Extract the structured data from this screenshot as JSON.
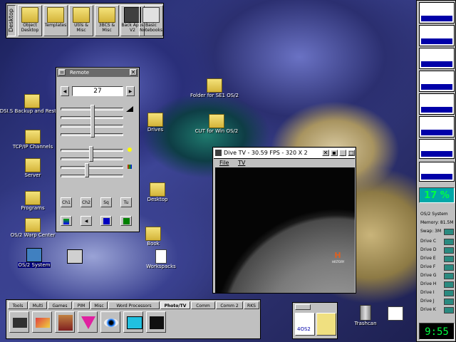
{
  "launchpad": {
    "tab_label": "Desktop",
    "items": [
      {
        "label": "Object Desktop"
      },
      {
        "label": "Templates"
      },
      {
        "label": "Utils & Misc"
      },
      {
        "label": "3BCS & Misc"
      },
      {
        "label": "Back Apps V2"
      },
      {
        "label": "Basic Notebooks"
      }
    ]
  },
  "desktop_icons": [
    {
      "label": "DSI.S Backup and Restore"
    },
    {
      "label": "TCP/IP Channels"
    },
    {
      "label": "Server"
    },
    {
      "label": "Programs"
    },
    {
      "label": "OS/2 Warp Center"
    },
    {
      "label": "OS/2 System"
    },
    {
      "label": "Folder for SE1 OS/2"
    },
    {
      "label": "CUT for Win OS/2"
    },
    {
      "label": "Drives"
    },
    {
      "label": "Desktop"
    },
    {
      "label": "Book"
    },
    {
      "label": "Workspacks"
    },
    {
      "label": "Trashcan"
    }
  ],
  "remote": {
    "title": "Remote",
    "channel": "27",
    "buttons": [
      "Ch1",
      "Ch2",
      "Sq",
      "Tu"
    ]
  },
  "dive": {
    "title": "Dive TV - 30.59 FPS - 320 X 2",
    "menu": [
      "File",
      "TV"
    ],
    "logo": "H",
    "logo_caption": "HISTORY"
  },
  "monitor": {
    "cpu": "17 %",
    "system_label": "OS/2 System",
    "memory": "Memory: 81.5M",
    "swap": "Swap: 3M",
    "drives": [
      "Drive C",
      "Drive D",
      "Drive E",
      "Drive F",
      "Drive G",
      "Drive H",
      "Drive I",
      "Drive J",
      "Drive K"
    ],
    "clock": "9:55"
  },
  "tabpad": {
    "tabs": [
      "Tools",
      "Multi",
      "Games",
      "PIM",
      "Misc",
      "Word Processors",
      "Photo/TV",
      "Comm",
      "Comm 2",
      "RKS"
    ],
    "active": "Photo/TV"
  },
  "mini_launchpad": {
    "label": "4OS2"
  },
  "colors": {
    "accent": "#0000a8",
    "cpu_green": "#00ff40"
  }
}
